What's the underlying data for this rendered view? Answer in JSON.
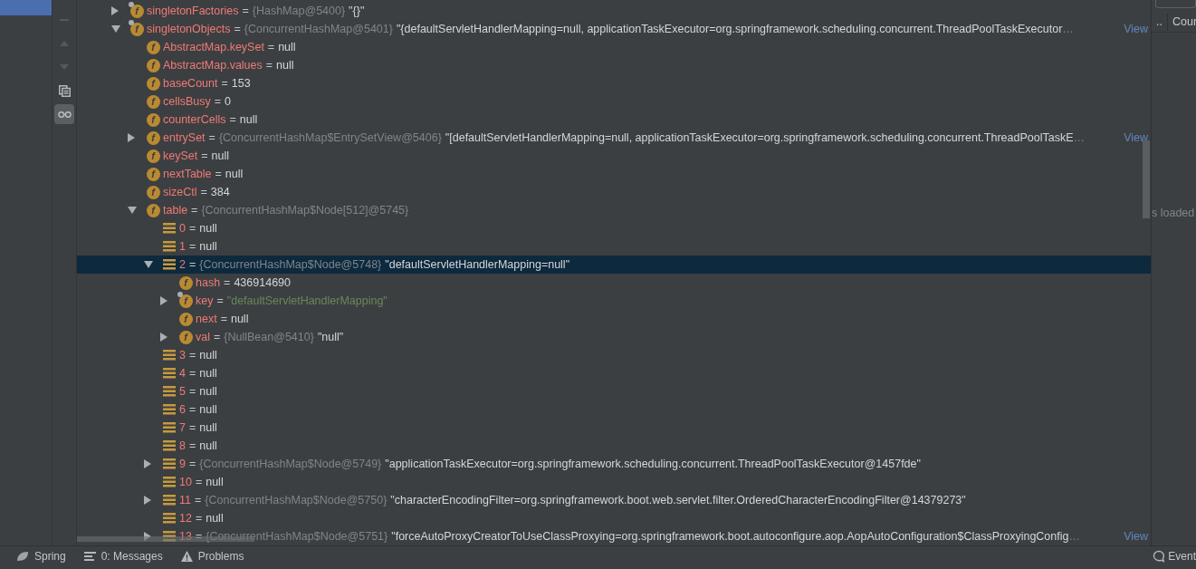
{
  "toolbar": [
    {
      "kind": "remove",
      "disabled": true
    },
    {
      "kind": "up",
      "disabled": true
    },
    {
      "kind": "down",
      "disabled": true
    },
    {
      "kind": "copy",
      "disabled": false
    },
    {
      "kind": "watches",
      "disabled": false,
      "on": true
    }
  ],
  "tree": [
    {
      "kind": "field",
      "glyph": "f",
      "name": "singletonFactories",
      "eq": "=",
      "type": "{HashMap@5400}",
      "value": "\"{}\"",
      "expanded": false,
      "overlay": true,
      "selected": false
    },
    {
      "kind": "field",
      "glyph": "f",
      "name": "singletonObjects",
      "eq": "=",
      "type": "{ConcurrentHashMap@5401}",
      "value": "\"{defaultServletHandlerMapping=null, applicationTaskExecutor=org.springframework.scheduling.concurrent.ThreadPoolTaskExecutor",
      "ellipsis": "…",
      "view": "View",
      "expanded": true,
      "overlay": true,
      "selected": false,
      "children": [
        {
          "kind": "field",
          "glyph": "f",
          "name": "AbstractMap.keySet",
          "eq": "=",
          "value": "null",
          "overlay": false,
          "selected": false
        },
        {
          "kind": "field",
          "glyph": "f",
          "name": "AbstractMap.values",
          "eq": "=",
          "value": "null",
          "overlay": false,
          "selected": false
        },
        {
          "kind": "field",
          "glyph": "f",
          "name": "baseCount",
          "eq": "=",
          "value": "153",
          "overlay": false,
          "selected": false
        },
        {
          "kind": "field",
          "glyph": "f",
          "name": "cellsBusy",
          "eq": "=",
          "value": "0",
          "overlay": false,
          "selected": false
        },
        {
          "kind": "field",
          "glyph": "f",
          "name": "counterCells",
          "eq": "=",
          "value": "null",
          "overlay": false,
          "selected": false
        },
        {
          "kind": "field",
          "glyph": "f",
          "name": "entrySet",
          "eq": "=",
          "type": "{ConcurrentHashMap$EntrySetView@5406}",
          "value": "\"[defaultServletHandlerMapping=null, applicationTaskExecutor=org.springframework.scheduling.concurrent.ThreadPoolTaskE",
          "ellipsis": "…",
          "view": "View",
          "expanded": false,
          "overlay": false,
          "selected": false
        },
        {
          "kind": "field",
          "glyph": "f",
          "name": "keySet",
          "eq": "=",
          "value": "null",
          "overlay": false,
          "selected": false
        },
        {
          "kind": "field",
          "glyph": "f",
          "name": "nextTable",
          "eq": "=",
          "value": "null",
          "overlay": false,
          "selected": false
        },
        {
          "kind": "field",
          "glyph": "f",
          "name": "sizeCtl",
          "eq": "=",
          "value": "384",
          "overlay": false,
          "selected": false
        },
        {
          "kind": "field",
          "glyph": "f",
          "name": "table",
          "eq": "=",
          "type": "{ConcurrentHashMap$Node[512]@5745}",
          "expanded": true,
          "overlay": false,
          "selected": false,
          "children": [
            {
              "kind": "element",
              "name": "0",
              "eq": "=",
              "value": "null",
              "selected": false
            },
            {
              "kind": "element",
              "name": "1",
              "eq": "=",
              "value": "null",
              "selected": false
            },
            {
              "kind": "element",
              "name": "2",
              "eq": "=",
              "type": "{ConcurrentHashMap$Node@5748}",
              "value": "\"defaultServletHandlerMapping=null\"",
              "expanded": true,
              "selected": true,
              "children": [
                {
                  "kind": "field",
                  "glyph": "f",
                  "name": "hash",
                  "eq": "=",
                  "value": "436914690",
                  "overlay": false,
                  "selected": false
                },
                {
                  "kind": "field",
                  "glyph": "f",
                  "name": "key",
                  "eq": "=",
                  "value": "\"defaultServletHandlerMapping\"",
                  "string_value": true,
                  "expanded": false,
                  "overlay": true,
                  "selected": false
                },
                {
                  "kind": "field",
                  "glyph": "f",
                  "name": "next",
                  "eq": "=",
                  "value": "null",
                  "overlay": false,
                  "selected": false
                },
                {
                  "kind": "field",
                  "glyph": "f",
                  "name": "val",
                  "eq": "=",
                  "type": "{NullBean@5410}",
                  "value": "\"null\"",
                  "expanded": false,
                  "overlay": false,
                  "selected": false
                }
              ]
            },
            {
              "kind": "element",
              "name": "3",
              "eq": "=",
              "value": "null",
              "selected": false
            },
            {
              "kind": "element",
              "name": "4",
              "eq": "=",
              "value": "null",
              "selected": false
            },
            {
              "kind": "element",
              "name": "5",
              "eq": "=",
              "value": "null",
              "selected": false
            },
            {
              "kind": "element",
              "name": "6",
              "eq": "=",
              "value": "null",
              "selected": false
            },
            {
              "kind": "element",
              "name": "7",
              "eq": "=",
              "value": "null",
              "selected": false
            },
            {
              "kind": "element",
              "name": "8",
              "eq": "=",
              "value": "null",
              "selected": false
            },
            {
              "kind": "element",
              "name": "9",
              "eq": "=",
              "type": "{ConcurrentHashMap$Node@5749}",
              "value": "\"applicationTaskExecutor=org.springframework.scheduling.concurrent.ThreadPoolTaskExecutor@1457fde\"",
              "expanded": false,
              "selected": false
            },
            {
              "kind": "element",
              "name": "10",
              "eq": "=",
              "value": "null",
              "selected": false
            },
            {
              "kind": "element",
              "name": "11",
              "eq": "=",
              "type": "{ConcurrentHashMap$Node@5750}",
              "value": "\"characterEncodingFilter=org.springframework.boot.web.servlet.filter.OrderedCharacterEncodingFilter@14379273\"",
              "expanded": false,
              "selected": false
            },
            {
              "kind": "element",
              "name": "12",
              "eq": "=",
              "value": "null",
              "selected": false
            },
            {
              "kind": "element",
              "name": "13",
              "eq": "=",
              "type": "{ConcurrentHashMap$Node@5751}",
              "value": "\"forceAutoProxyCreatorToUseClassProxying=org.springframework.boot.autoconfigure.aop.AopAutoConfiguration$ClassProxyingConfig",
              "ellipsis": "…",
              "view": "View",
              "expanded": false,
              "selected": false
            }
          ]
        }
      ]
    }
  ],
  "right_panel": {
    "tabs": [
      {
        "label": "..",
        "selected": false
      },
      {
        "label": "Cour",
        "selected": false
      }
    ],
    "message": "s loaded"
  },
  "status_bar": {
    "items": [
      {
        "kind": "spring",
        "label": "Spring"
      },
      {
        "kind": "messages",
        "label": "0: Messages"
      },
      {
        "kind": "problems",
        "label": "Problems"
      }
    ],
    "right": {
      "kind": "event",
      "label": "Event"
    }
  }
}
